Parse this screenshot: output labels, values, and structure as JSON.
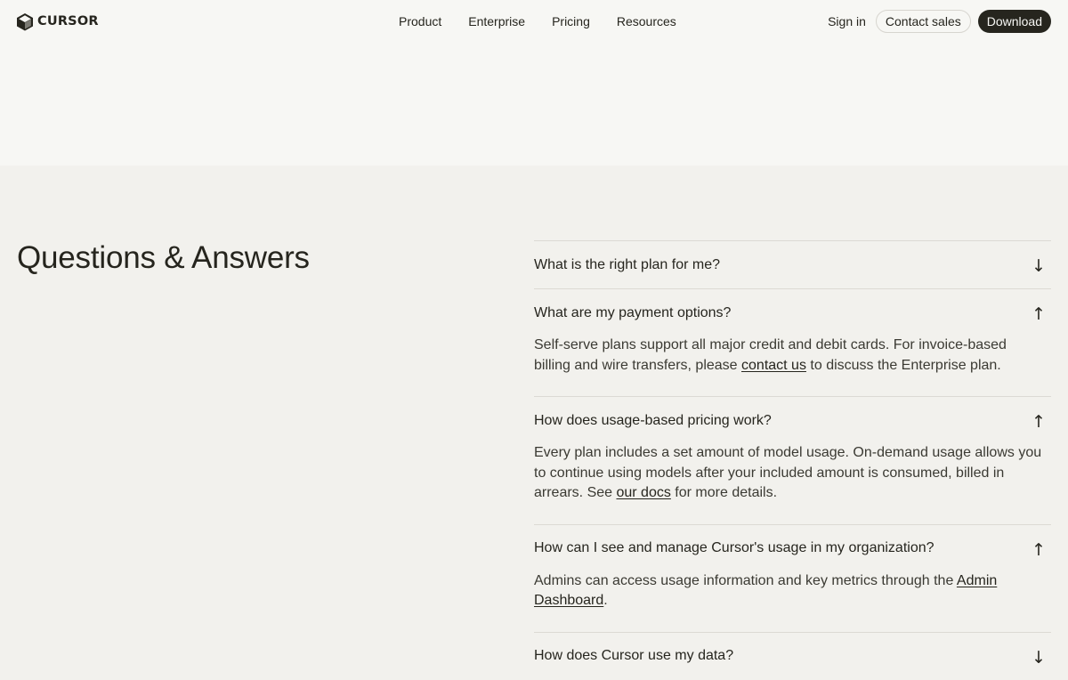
{
  "brand": {
    "name": "CURSOR"
  },
  "nav": {
    "links": [
      "Product",
      "Enterprise",
      "Pricing",
      "Resources"
    ],
    "sign_in": "Sign in",
    "contact_sales": "Contact sales",
    "download": "Download"
  },
  "faq": {
    "title": "Questions & Answers",
    "items": [
      {
        "question": "What is the right plan for me?",
        "arrow": "↓",
        "expanded": false
      },
      {
        "question": "What are my payment options?",
        "arrow": "↑",
        "expanded": true,
        "answer_before": "Self-serve plans support all major credit and debit cards. For invoice-based billing and wire transfers, please ",
        "answer_link": "contact us",
        "answer_after": " to discuss the Enterprise plan."
      },
      {
        "question": "How does usage-based pricing work?",
        "arrow": "↑",
        "expanded": true,
        "answer_before": "Every plan includes a set amount of model usage. On-demand usage allows you to continue using models after your included amount is consumed, billed in arrears. See ",
        "answer_link": "our docs",
        "answer_after": " for more details."
      },
      {
        "question": "How can I see and manage Cursor's usage in my organization?",
        "arrow": "↑",
        "expanded": true,
        "answer_before": "Admins can access usage information and key metrics through the ",
        "answer_link": "Admin Dashboard",
        "answer_after": "."
      },
      {
        "question": "How does Cursor use my data?",
        "arrow": "↓",
        "expanded": false
      }
    ]
  },
  "colors": {
    "text": "#26251e",
    "background_top": "#f7f7f4",
    "background_section": "#f2f1ed",
    "button_dark": "#26251e"
  }
}
